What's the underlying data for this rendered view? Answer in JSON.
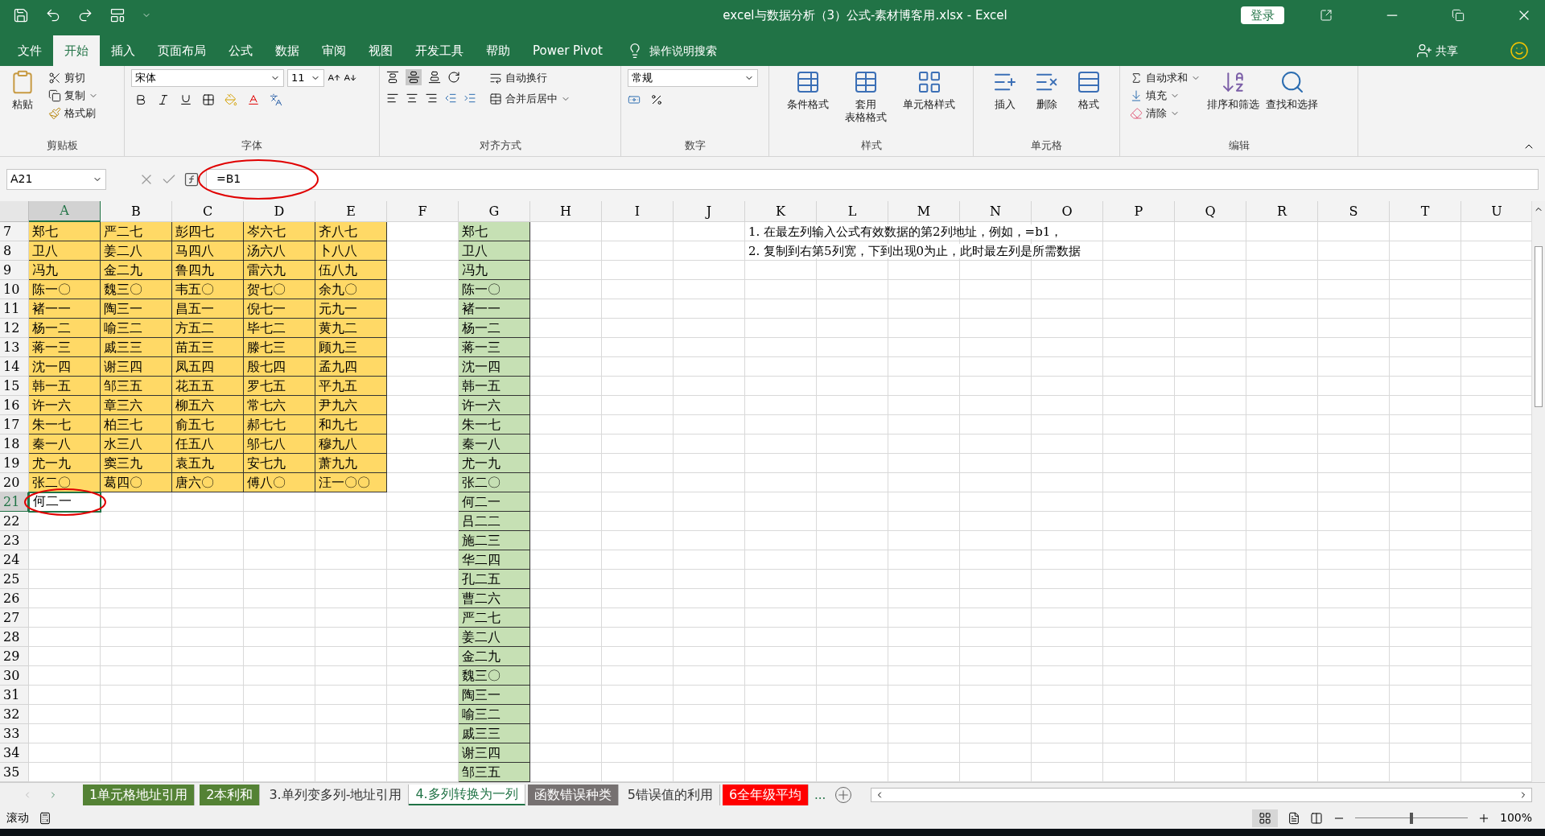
{
  "window": {
    "title": "excel与数据分析（3）公式-素材博客用.xlsx  -  Excel",
    "login_button": "登录"
  },
  "ribbon_tabs": [
    {
      "label": "文件",
      "selected": false
    },
    {
      "label": "开始",
      "selected": true
    },
    {
      "label": "插入",
      "selected": false
    },
    {
      "label": "页面布局",
      "selected": false
    },
    {
      "label": "公式",
      "selected": false
    },
    {
      "label": "数据",
      "selected": false
    },
    {
      "label": "审阅",
      "selected": false
    },
    {
      "label": "视图",
      "selected": false
    },
    {
      "label": "开发工具",
      "selected": false
    },
    {
      "label": "帮助",
      "selected": false
    },
    {
      "label": "Power Pivot",
      "selected": false
    }
  ],
  "tell_me": "操作说明搜索",
  "share": "共享",
  "ribbon_groups": [
    {
      "kind": "clipboard",
      "label": "剪贴板",
      "items": [
        "粘贴",
        "剪切",
        "复制",
        "格式刷"
      ]
    },
    {
      "kind": "font",
      "label": "字体",
      "font": "宋体",
      "size": "11"
    },
    {
      "kind": "align",
      "label": "对齐方式",
      "items": [
        "自动换行",
        "合并后居中"
      ]
    },
    {
      "kind": "number",
      "label": "数字",
      "format": "常规"
    },
    {
      "kind": "big",
      "label": "样式",
      "items": [
        {
          "lines": [
            "条件格式"
          ]
        },
        {
          "lines": [
            "套用",
            "表格格式"
          ]
        },
        {
          "lines": [
            "单元格样式"
          ]
        }
      ]
    },
    {
      "kind": "big",
      "label": "单元格",
      "items": [
        {
          "lines": [
            "插入"
          ]
        },
        {
          "lines": [
            "删除"
          ]
        },
        {
          "lines": [
            "格式"
          ]
        }
      ]
    },
    {
      "kind": "editing",
      "label": "编辑",
      "items": [
        "自动求和",
        "填充",
        "清除"
      ],
      "big": [
        "排序和筛选",
        "查找和选择"
      ]
    }
  ],
  "name_box": "A21",
  "formula": "=B1",
  "column_headers": [
    {
      "label": "A",
      "selected": true
    },
    {
      "label": "B",
      "selected": false
    },
    {
      "label": "C",
      "selected": false
    },
    {
      "label": "D",
      "selected": false
    },
    {
      "label": "E",
      "selected": false
    },
    {
      "label": "F",
      "selected": false
    },
    {
      "label": "G",
      "selected": false
    },
    {
      "label": "H",
      "selected": false
    },
    {
      "label": "I",
      "selected": false
    },
    {
      "label": "J",
      "selected": false
    },
    {
      "label": "K",
      "selected": false
    },
    {
      "label": "L",
      "selected": false
    },
    {
      "label": "M",
      "selected": false
    },
    {
      "label": "N",
      "selected": false
    },
    {
      "label": "O",
      "selected": false
    },
    {
      "label": "P",
      "selected": false
    },
    {
      "label": "Q",
      "selected": false
    },
    {
      "label": "R",
      "selected": false
    },
    {
      "label": "S",
      "selected": false
    },
    {
      "label": "T",
      "selected": false
    },
    {
      "label": "U",
      "selected": false
    }
  ],
  "row_numbers": [
    {
      "label": "7",
      "selected": false
    },
    {
      "label": "8",
      "selected": false
    },
    {
      "label": "9",
      "selected": false
    },
    {
      "label": "10",
      "selected": false
    },
    {
      "label": "11",
      "selected": false
    },
    {
      "label": "12",
      "selected": false
    },
    {
      "label": "13",
      "selected": false
    },
    {
      "label": "14",
      "selected": false
    },
    {
      "label": "15",
      "selected": false
    },
    {
      "label": "16",
      "selected": false
    },
    {
      "label": "17",
      "selected": false
    },
    {
      "label": "18",
      "selected": false
    },
    {
      "label": "19",
      "selected": false
    },
    {
      "label": "20",
      "selected": false
    },
    {
      "label": "21",
      "selected": true
    },
    {
      "label": "22",
      "selected": false
    },
    {
      "label": "23",
      "selected": false
    },
    {
      "label": "24",
      "selected": false
    },
    {
      "label": "25",
      "selected": false
    },
    {
      "label": "26",
      "selected": false
    },
    {
      "label": "27",
      "selected": false
    },
    {
      "label": "28",
      "selected": false
    },
    {
      "label": "29",
      "selected": false
    },
    {
      "label": "30",
      "selected": false
    },
    {
      "label": "31",
      "selected": false
    },
    {
      "label": "32",
      "selected": false
    },
    {
      "label": "33",
      "selected": false
    },
    {
      "label": "34",
      "selected": false
    },
    {
      "label": "35",
      "selected": false
    }
  ],
  "source_block": [
    [
      "郑七",
      "严二七",
      "彭四七",
      "岑六七",
      "齐八七"
    ],
    [
      "卫八",
      "姜二八",
      "马四八",
      "汤六八",
      "卜八八"
    ],
    [
      "冯九",
      "金二九",
      "鲁四九",
      "雷六九",
      "伍八九"
    ],
    [
      "陈一〇",
      "魏三〇",
      "韦五〇",
      "贺七〇",
      "余九〇"
    ],
    [
      "褚一一",
      "陶三一",
      "昌五一",
      "倪七一",
      "元九一"
    ],
    [
      "杨一二",
      "喻三二",
      "方五二",
      "毕七二",
      "黄九二"
    ],
    [
      "蒋一三",
      "戚三三",
      "苗五三",
      "滕七三",
      "顾九三"
    ],
    [
      "沈一四",
      "谢三四",
      "凤五四",
      "殷七四",
      "孟九四"
    ],
    [
      "韩一五",
      "邹三五",
      "花五五",
      "罗七五",
      "平九五"
    ],
    [
      "许一六",
      "章三六",
      "柳五六",
      "常七六",
      "尹九六"
    ],
    [
      "朱一七",
      "柏三七",
      "俞五七",
      "郝七七",
      "和九七"
    ],
    [
      "秦一八",
      "水三八",
      "任五八",
      "邬七八",
      "穆九八"
    ],
    [
      "尤一九",
      "窦三九",
      "袁五九",
      "安七九",
      "萧九九"
    ],
    [
      "张二〇",
      "葛四〇",
      "唐六〇",
      "傅八〇",
      "汪一〇〇"
    ]
  ],
  "active_cell": "何二一",
  "result_column": [
    "郑七",
    "卫八",
    "冯九",
    "陈一〇",
    "褚一一",
    "杨一二",
    "蒋一三",
    "沈一四",
    "韩一五",
    "许一六",
    "朱一七",
    "秦一八",
    "尤一九",
    "张二〇",
    "何二一",
    "吕二二",
    "施二三",
    "华二四",
    "孔二五",
    "曹二六",
    "严二七",
    "姜二八",
    "金二九",
    "魏三〇",
    "陶三一",
    "喻三二",
    "戚三三",
    "谢三四",
    "邹三五"
  ],
  "notes": [
    "1. 在最左列输入公式有效数据的第2列地址，例如，=b1，",
    "2. 复制到右第5列宽，下到出现0为止，此时最左列是所需数据"
  ],
  "sheet_tabs": [
    {
      "label": "1单元格地址引用",
      "selected": false,
      "color": "#548235"
    },
    {
      "label": "2本利和",
      "selected": false,
      "color": "#548235"
    },
    {
      "label": "3.单列变多列-地址引用",
      "selected": false
    },
    {
      "label": "4.多列转换为一列",
      "selected": true
    },
    {
      "label": "函数错误种类",
      "selected": false,
      "color": "#767171"
    },
    {
      "label": "5错误值的利用",
      "selected": false
    },
    {
      "label": "6全年级平均",
      "selected": false,
      "color": "#ff0000"
    }
  ],
  "more_tabs": "...",
  "status": {
    "mode": "滚动",
    "zoom": "100%",
    "zoom_level": {
      "level": 0.5
    }
  }
}
